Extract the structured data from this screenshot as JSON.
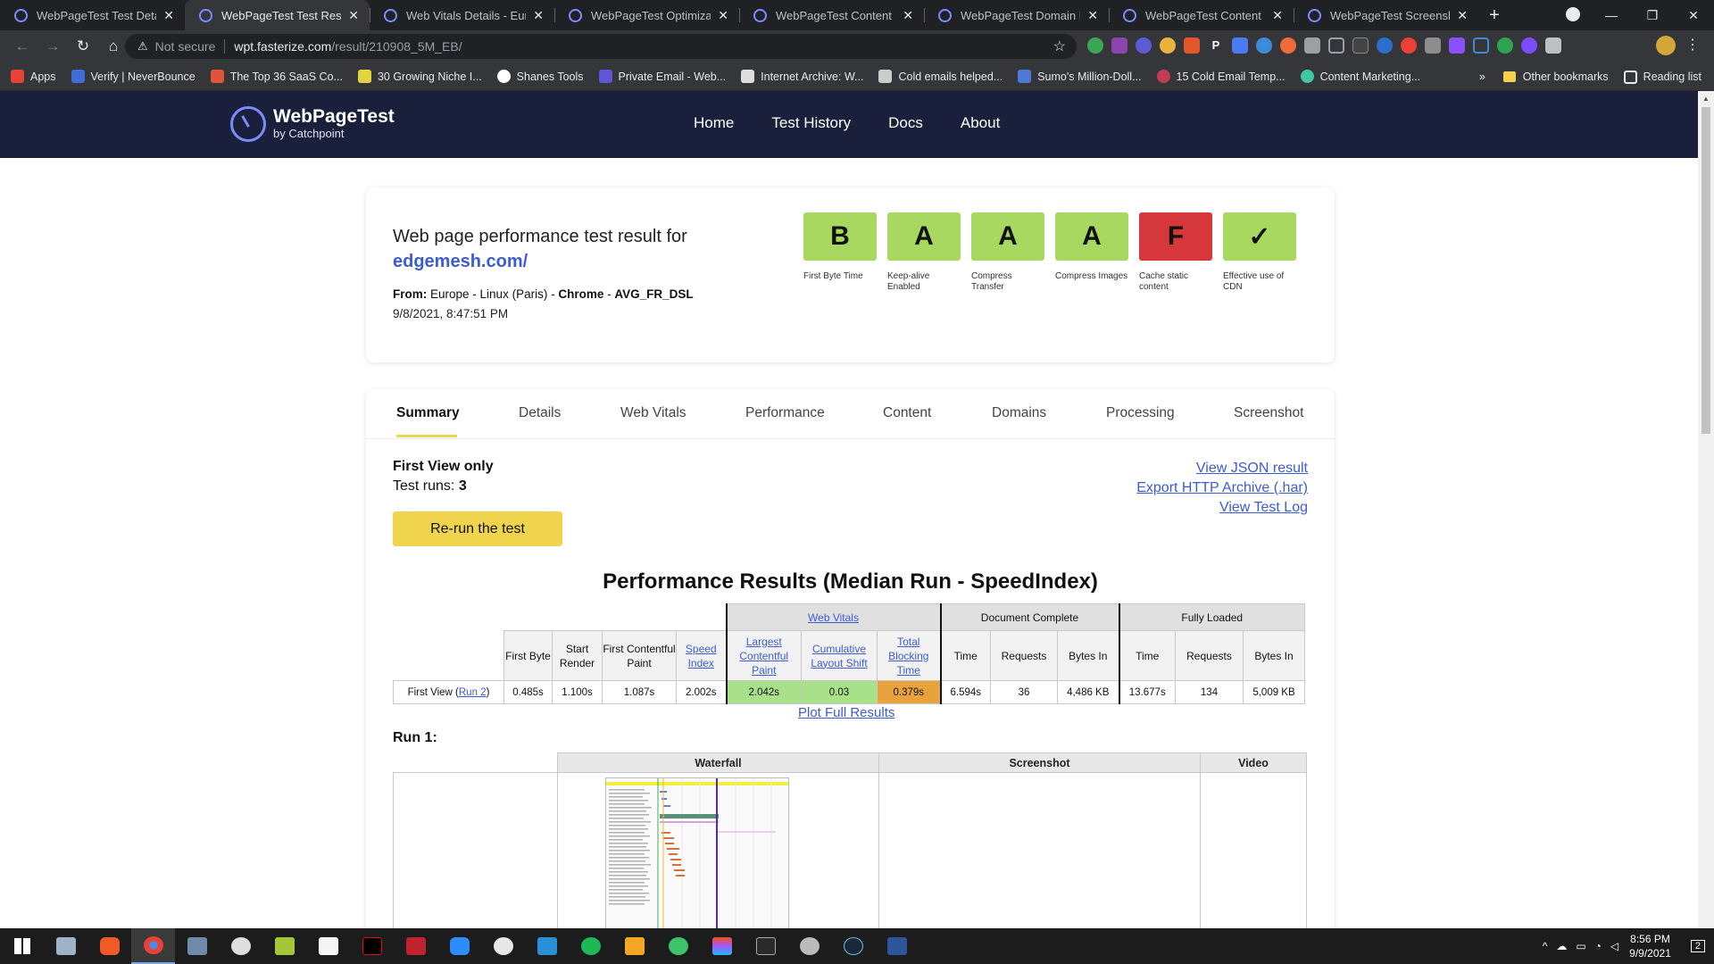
{
  "browser": {
    "tabs": [
      {
        "title": "WebPageTest Test Details -",
        "active": false
      },
      {
        "title": "WebPageTest Test Result -",
        "active": true
      },
      {
        "title": "Web Vitals Details - Europe",
        "active": false
      },
      {
        "title": "WebPageTest Optimization",
        "active": false
      },
      {
        "title": "WebPageTest Content Brea",
        "active": false
      },
      {
        "title": "WebPageTest Domain Brea",
        "active": false
      },
      {
        "title": "WebPageTest Content Brea",
        "active": false
      },
      {
        "title": "WebPageTest Screenshots",
        "active": false
      }
    ],
    "new_tab": "+",
    "security": "Not secure",
    "url_host": "wpt.fasterize.com",
    "url_path": "/result/210908_5M_EB/",
    "bookmarks": [
      {
        "label": "Apps",
        "color": "#e94235"
      },
      {
        "label": "Verify | NeverBounce",
        "color": "#3d6fd6"
      },
      {
        "label": "The Top 36 SaaS Co...",
        "color": "#e0553a"
      },
      {
        "label": "30 Growing Niche I...",
        "color": "#e5d341"
      },
      {
        "label": "Shanes Tools",
        "color": "#ffffff"
      },
      {
        "label": "Private Email - Web...",
        "color": "#6055d6"
      },
      {
        "label": "Internet Archive: W...",
        "color": "#dddddd"
      },
      {
        "label": "Cold emails helped...",
        "color": "#cccccc"
      },
      {
        "label": "Sumo's Million-Doll...",
        "color": "#4e7ad6"
      },
      {
        "label": "15 Cold Email Temp...",
        "color": "#c43b56"
      },
      {
        "label": "Content Marketing...",
        "color": "#3ec9a0"
      }
    ],
    "bookmarks_more": "»",
    "other_bookmarks": "Other bookmarks",
    "reading_list": "Reading list"
  },
  "site": {
    "logo_title": "WebPageTest",
    "logo_sub": "by Catchpoint",
    "nav": [
      "Home",
      "Test History",
      "Docs",
      "About"
    ]
  },
  "result": {
    "heading": "Web page performance test result for",
    "url": "edgemesh.com/",
    "from_label": "From:",
    "location": "Europe - Linux (Paris) -",
    "browser": "Chrome",
    "dash": "-",
    "connection": "AVG_FR_DSL",
    "date": "9/8/2021, 8:47:51 PM",
    "grades": [
      {
        "grade": "B",
        "label": "First Byte Time",
        "status": "pass"
      },
      {
        "grade": "A",
        "label": "Keep-alive Enabled",
        "status": "pass"
      },
      {
        "grade": "A",
        "label": "Compress Transfer",
        "status": "pass"
      },
      {
        "grade": "A",
        "label": "Compress Images",
        "status": "pass"
      },
      {
        "grade": "F",
        "label": "Cache static content",
        "status": "fail"
      },
      {
        "grade": "✓",
        "label": "Effective use of CDN",
        "status": "pass"
      }
    ]
  },
  "subtabs": [
    "Summary",
    "Details",
    "Web Vitals",
    "Performance",
    "Content",
    "Domains",
    "Processing",
    "Screenshot"
  ],
  "summary": {
    "first_view_only": "First View only",
    "test_runs_label": "Test runs:",
    "test_runs": "3",
    "rerun": "Re-run the test",
    "links": [
      "View JSON result",
      "Export HTTP Archive (.har)",
      "View Test Log"
    ],
    "perf_title": "Performance Results (Median Run - SpeedIndex)",
    "groups": {
      "web_vitals": "Web Vitals",
      "doc_complete": "Document Complete",
      "fully_loaded": "Fully Loaded"
    },
    "headers": {
      "first_byte": "First Byte",
      "start_render": "Start Render",
      "fcp": "First Contentful Paint",
      "speed_index": "Speed Index",
      "lcp": "Largest Contentful Paint",
      "cls": "Cumulative Layout Shift",
      "tbt": "Total Blocking Time",
      "time": "Time",
      "requests": "Requests",
      "bytes_in": "Bytes In"
    },
    "row": {
      "label": "First View (",
      "run_link": "Run 2",
      "label_end": ")",
      "first_byte": "0.485s",
      "start_render": "1.100s",
      "fcp": "1.087s",
      "speed_index": "2.002s",
      "lcp": "2.042s",
      "cls": "0.03",
      "tbt": "0.379s",
      "dc_time": "6.594s",
      "dc_requests": "36",
      "dc_bytes": "4,486 KB",
      "fl_time": "13.677s",
      "fl_requests": "134",
      "fl_bytes": "5,009 KB"
    },
    "plot_full": "Plot Full Results",
    "run1_label": "Run 1:",
    "run_cols": [
      "Waterfall",
      "Screenshot",
      "Video"
    ]
  },
  "taskbar": {
    "time": "8:56 PM",
    "date": "9/9/2021",
    "notifications": "2"
  }
}
